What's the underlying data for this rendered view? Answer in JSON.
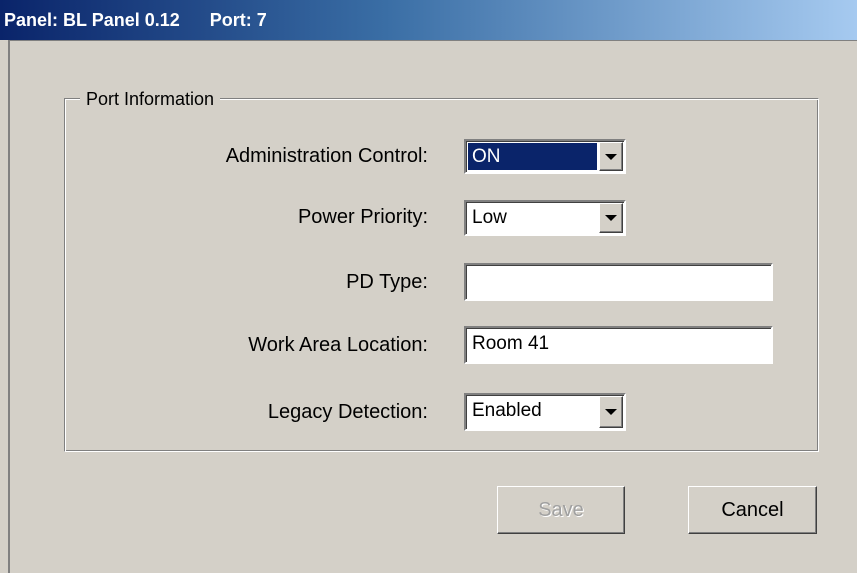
{
  "window": {
    "title": "Panel: BL Panel 0.12",
    "port": "Port: 7"
  },
  "group": {
    "title": "Port Information"
  },
  "fields": {
    "admin_control": {
      "label": "Administration Control:",
      "value": "ON",
      "type": "select"
    },
    "power_priority": {
      "label": "Power Priority:",
      "value": "Low",
      "type": "select"
    },
    "pd_type": {
      "label": "PD Type:",
      "value": "",
      "type": "text"
    },
    "work_area": {
      "label": "Work Area Location:",
      "value": "Room 41",
      "type": "text"
    },
    "legacy_detection": {
      "label": "Legacy Detection:",
      "value": "Enabled",
      "type": "select"
    }
  },
  "buttons": {
    "save": "Save",
    "cancel": "Cancel"
  },
  "icons": {
    "dropdown": "chevron-down-icon"
  },
  "colors": {
    "titlebar_start": "#0a246a",
    "titlebar_end": "#a6caf0",
    "selection": "#0a246a",
    "dialog_bg": "#d4d0c8"
  }
}
